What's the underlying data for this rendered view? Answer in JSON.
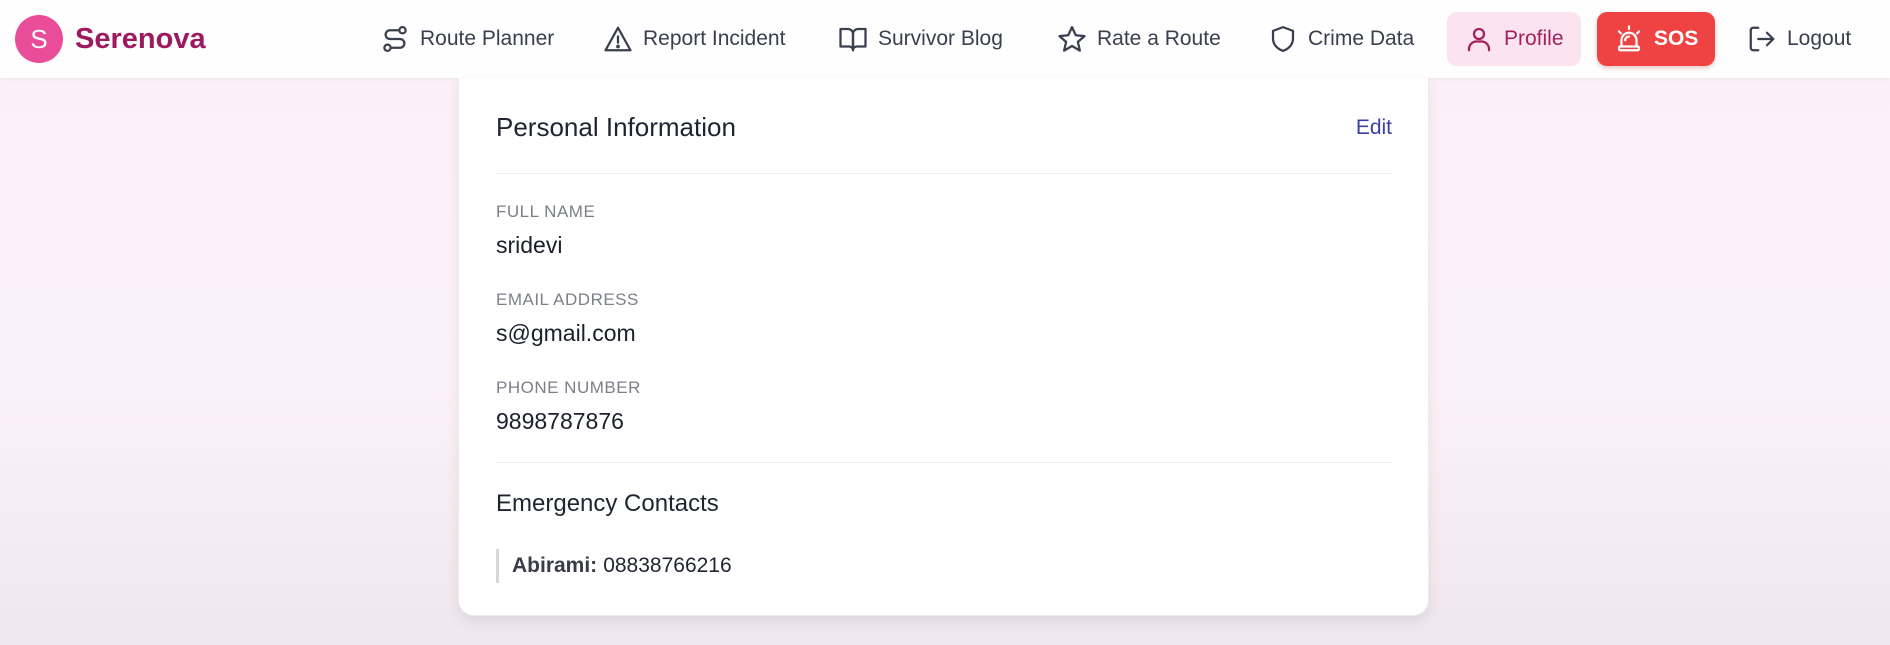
{
  "brand": {
    "initial": "S",
    "name": "Serenova"
  },
  "nav": {
    "route_planner": "Route Planner",
    "report_incident": "Report Incident",
    "survivor_blog": "Survivor Blog",
    "rate_route": "Rate a Route",
    "crime_data": "Crime Data",
    "profile": "Profile",
    "sos": "SOS",
    "logout": "Logout"
  },
  "icons": {
    "route_planner": "route-icon",
    "report_incident": "warning-triangle-icon",
    "survivor_blog": "open-book-icon",
    "rate_route": "star-icon",
    "crime_data": "shield-icon",
    "profile": "user-icon",
    "sos": "siren-icon",
    "logout": "logout-icon"
  },
  "colors": {
    "brand": "#e94c98",
    "brand_text": "#9c1a5f",
    "sos": "#ef4343",
    "profile_active_bg": "#fbe3ef",
    "edit_link": "#3b3fa3"
  },
  "personal_info": {
    "title": "Personal Information",
    "edit_label": "Edit",
    "full_name_label": "FULL NAME",
    "full_name": "sridevi",
    "email_label": "EMAIL ADDRESS",
    "email": "s@gmail.com",
    "phone_label": "PHONE NUMBER",
    "phone": "9898787876"
  },
  "emergency": {
    "title": "Emergency Contacts",
    "contacts": [
      {
        "name": "Abirami:",
        "phone": "08838766216"
      }
    ]
  }
}
